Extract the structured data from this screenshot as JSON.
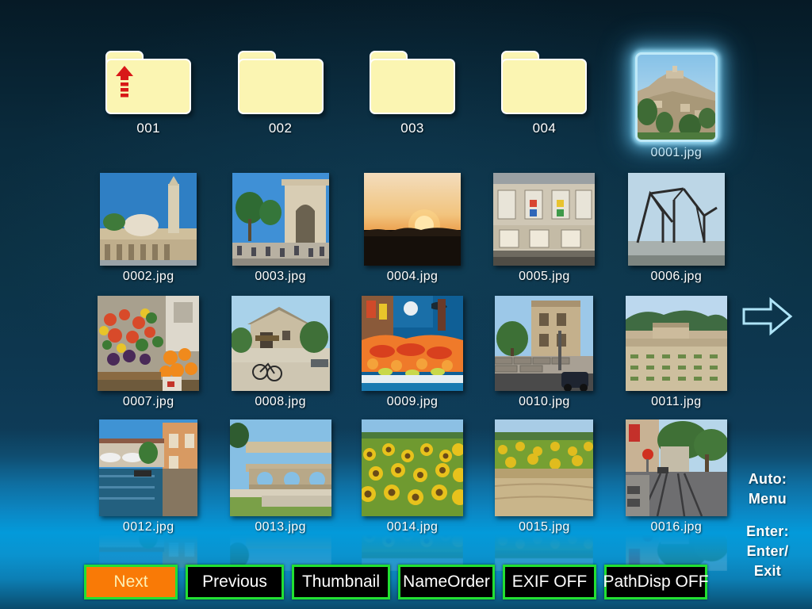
{
  "app": {
    "title": "Photo Viewer Thumbnail Browser",
    "background_top_color": "#07202e",
    "background_bottom_color": "#039ada",
    "selection_glow_color": "#bfe9f8",
    "folder_color": "#fbf5b2",
    "button_border_color": "#22e032",
    "button_active_color": "#f97a06",
    "button_active_text_color": "#fdf0b4"
  },
  "folders": [
    {
      "label": "001",
      "icon": "folder-up-icon",
      "has_up_arrow": true
    },
    {
      "label": "002",
      "icon": "folder-icon",
      "has_up_arrow": false
    },
    {
      "label": "003",
      "icon": "folder-icon",
      "has_up_arrow": false
    },
    {
      "label": "004",
      "icon": "folder-icon",
      "has_up_arrow": false
    }
  ],
  "selected_item": {
    "label": "0001.jpg",
    "selected": true
  },
  "thumbnails": {
    "row1": [
      {
        "label": "0002.jpg"
      },
      {
        "label": "0003.jpg"
      },
      {
        "label": "0004.jpg"
      },
      {
        "label": "0005.jpg"
      },
      {
        "label": "0006.jpg"
      }
    ],
    "row2": [
      {
        "label": "0007.jpg"
      },
      {
        "label": "0008.jpg"
      },
      {
        "label": "0009.jpg"
      },
      {
        "label": "0010.jpg"
      },
      {
        "label": "0011.jpg"
      }
    ],
    "row3": [
      {
        "label": "0012.jpg"
      },
      {
        "label": "0013.jpg"
      },
      {
        "label": "0014.jpg"
      },
      {
        "label": "0015.jpg"
      },
      {
        "label": "0016.jpg"
      }
    ]
  },
  "navigation": {
    "next_page_arrow": "arrow-right-icon"
  },
  "help": {
    "auto_label": "Auto:",
    "auto_value": "Menu",
    "enter_label": "Enter:",
    "enter_value_line1": "Enter/",
    "enter_value_line2": "Exit"
  },
  "buttons": [
    {
      "label": "Next",
      "active": true
    },
    {
      "label": "Previous",
      "active": false
    },
    {
      "label": "Thumbnail",
      "active": false
    },
    {
      "label": "NameOrder",
      "active": false
    },
    {
      "label": "EXIF OFF",
      "active": false
    },
    {
      "label": "PathDisp OFF",
      "active": false
    }
  ]
}
